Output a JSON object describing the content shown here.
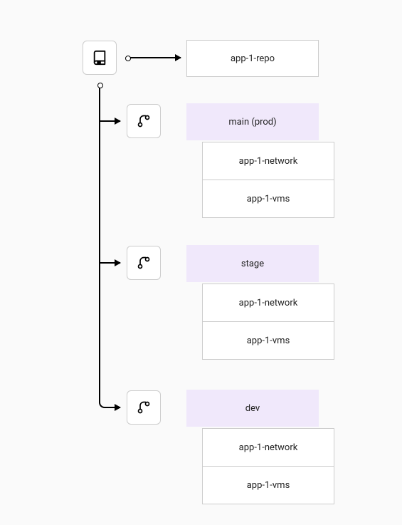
{
  "repo": {
    "name": "app-1-repo"
  },
  "branches": [
    {
      "label": "main (prod)",
      "stacks": [
        "app-1-network",
        "app-1-vms"
      ]
    },
    {
      "label": "stage",
      "stacks": [
        "app-1-network",
        "app-1-vms"
      ]
    },
    {
      "label": "dev",
      "stacks": [
        "app-1-network",
        "app-1-vms"
      ]
    }
  ],
  "colors": {
    "branch_bg": "#f0e8fb",
    "box_border": "#cccccc",
    "page_bg": "#fafafa"
  }
}
